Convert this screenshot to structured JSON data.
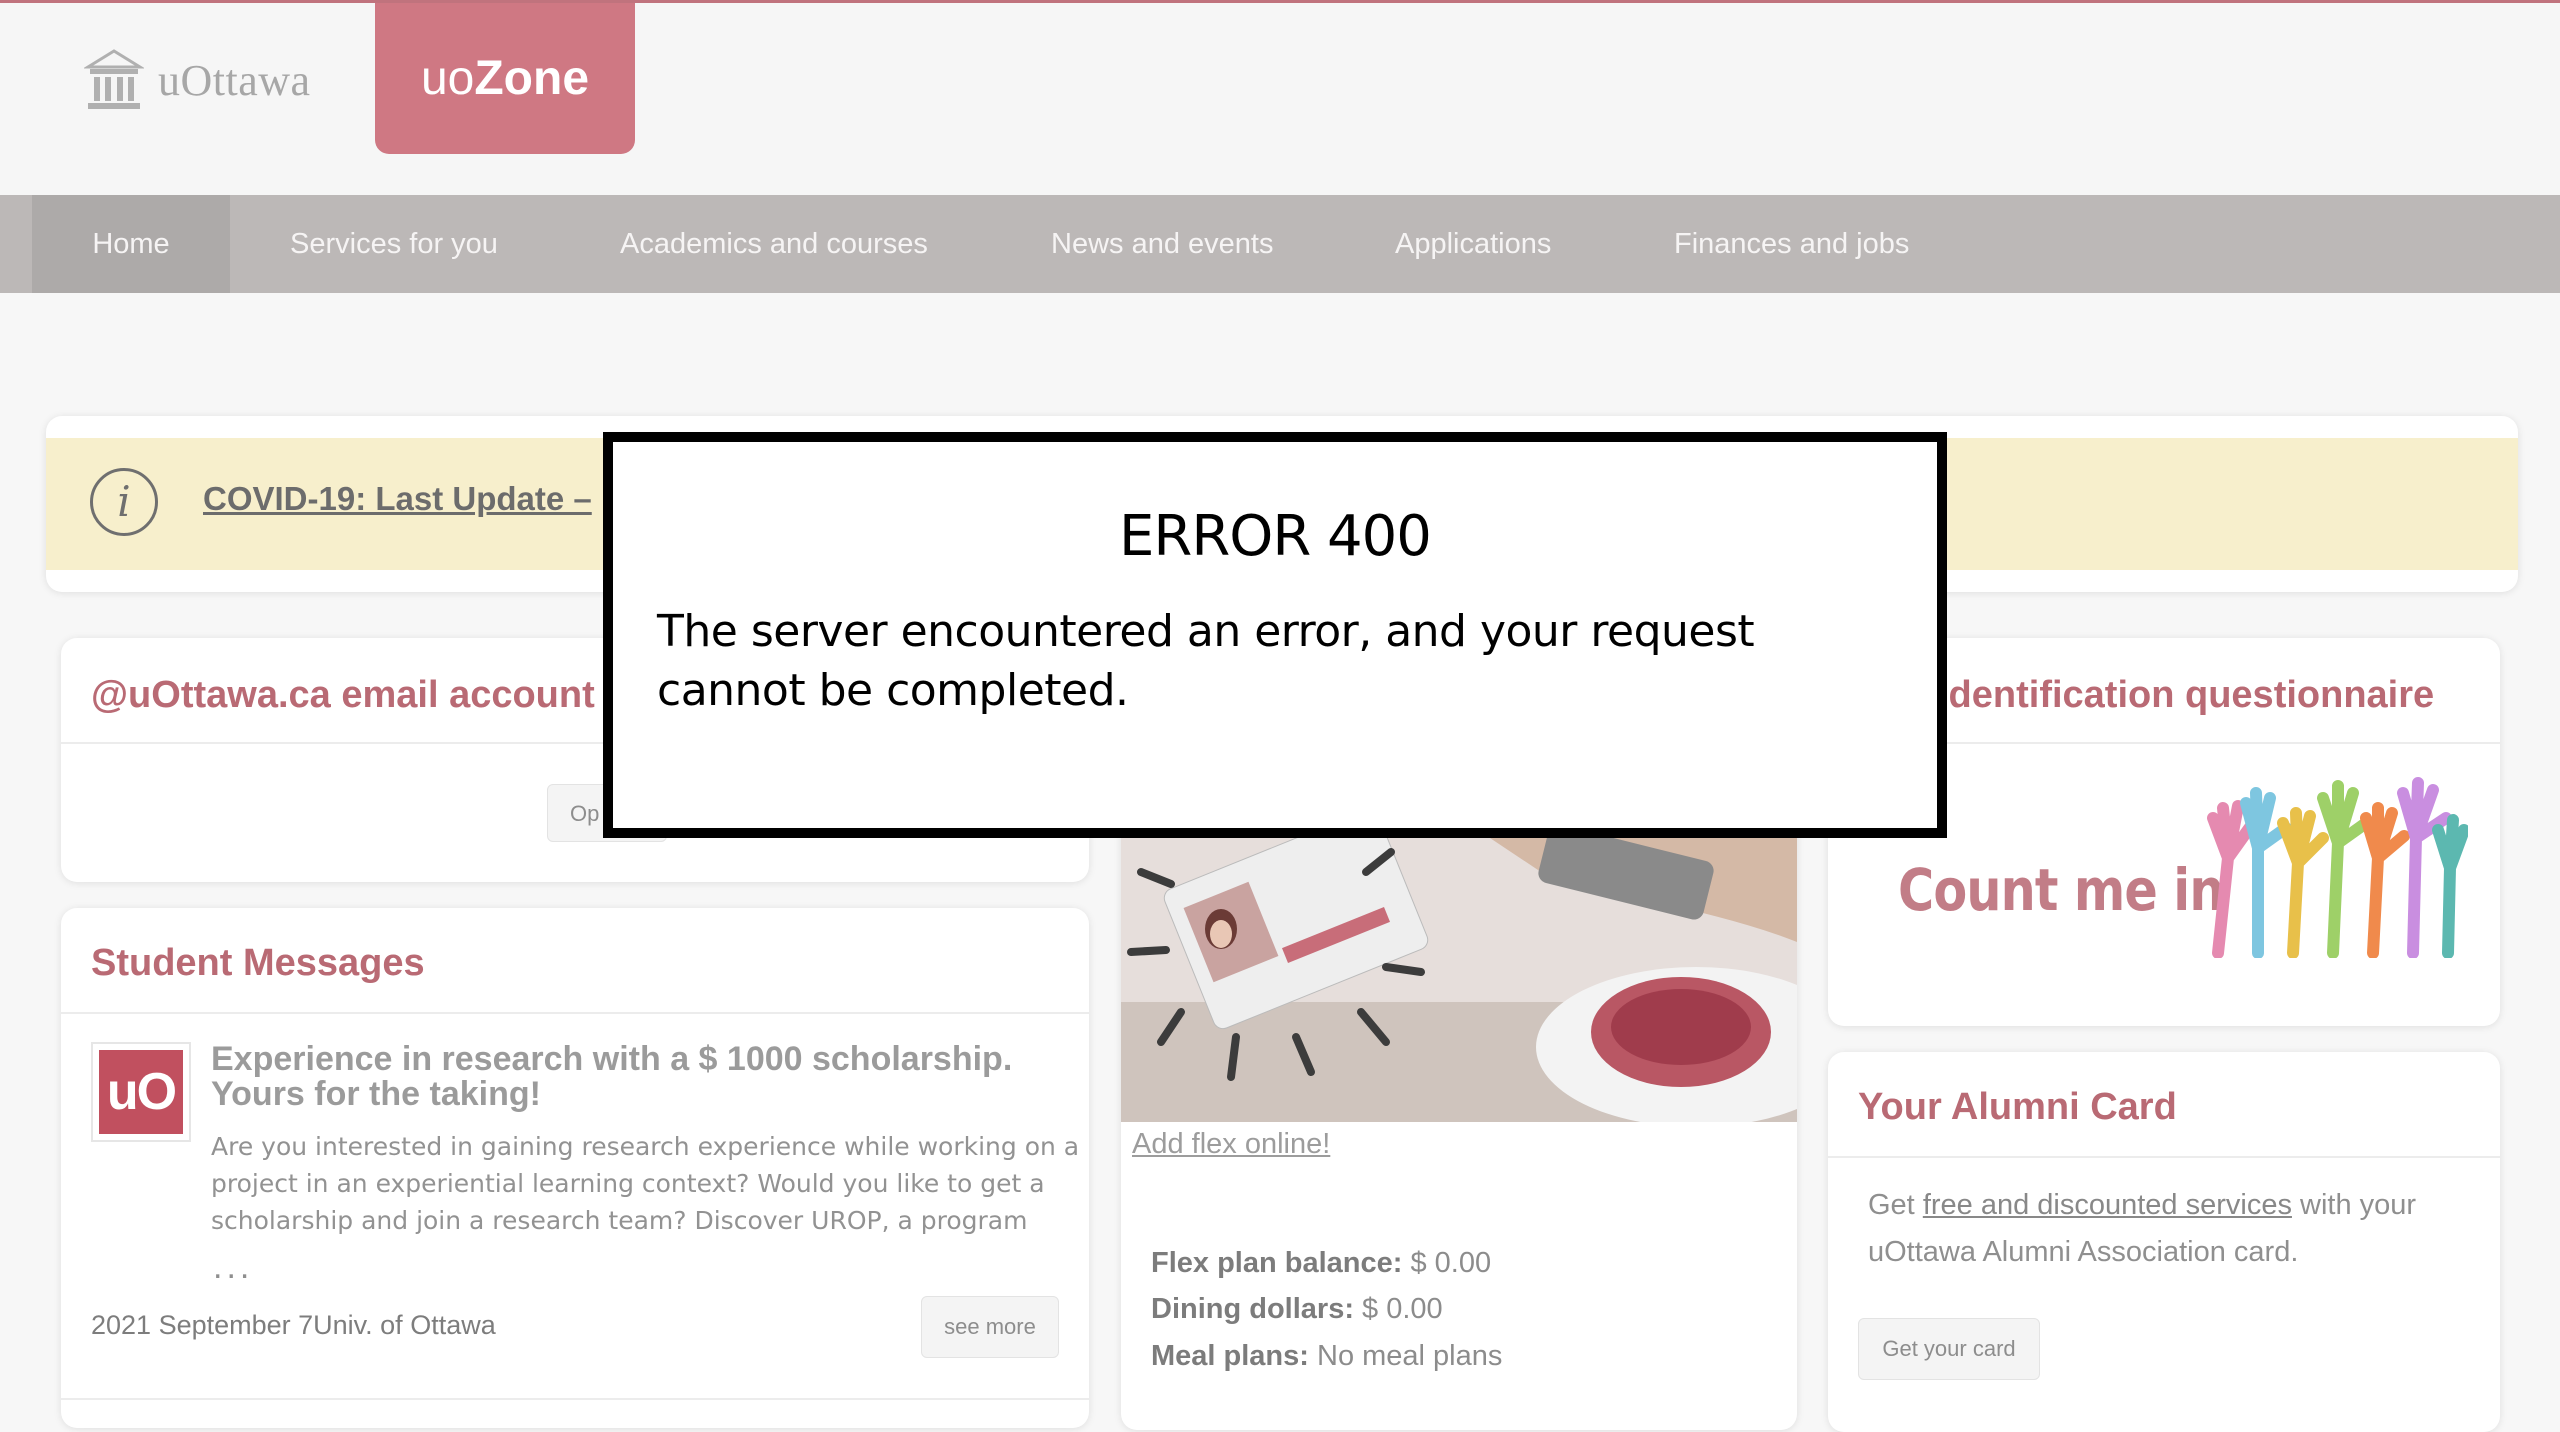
{
  "brand": {
    "university": "uOttawa",
    "portal_prefix": "uo",
    "portal_name": "Zone"
  },
  "nav": {
    "home": "Home",
    "services": "Services for you",
    "academics": "Academics and courses",
    "news": "News and events",
    "applications": "Applications",
    "finances": "Finances and jobs"
  },
  "alert": {
    "text": "COVID-19: Last Update –"
  },
  "email_card": {
    "title": "@uOttawa.ca email account",
    "button": "Op"
  },
  "messages": {
    "title": "Student Messages",
    "item": {
      "logo": "uO",
      "title": "Experience in research with a $ 1000 scholarship. Yours for the taking!",
      "body": "Are you interested in gaining research experience while working on a project in an experiential learning context? Would you like to get a scholarship and join a research team? Discover UROP, a program",
      "ellipsis": "...",
      "meta": "2021 September 7Univ. of Ottawa",
      "button": "see more"
    }
  },
  "flex": {
    "link": "Add flex online!",
    "balance_label": "Flex plan balance:",
    "balance_value": " $ 0.00",
    "dining_label": "Dining dollars:",
    "dining_value": " $ 0.00",
    "meal_label": "Meal plans:",
    "meal_value": " No meal plans"
  },
  "questionnaire": {
    "title": "identification questionnaire",
    "banner": "Count me in"
  },
  "alumni": {
    "title": "Your Alumni Card",
    "text_before": "Get ",
    "link": "free and discounted services",
    "text_after": " with your uOttawa Alumni Association card.",
    "button": "Get your card"
  },
  "modal": {
    "title": "ERROR 400",
    "message": "The server encountered an error, and your request cannot be completed."
  },
  "colors": {
    "brand": "#cf7883",
    "title": "#b96a74",
    "nav": "#bcb8b7",
    "alert": "#f7efcc"
  }
}
